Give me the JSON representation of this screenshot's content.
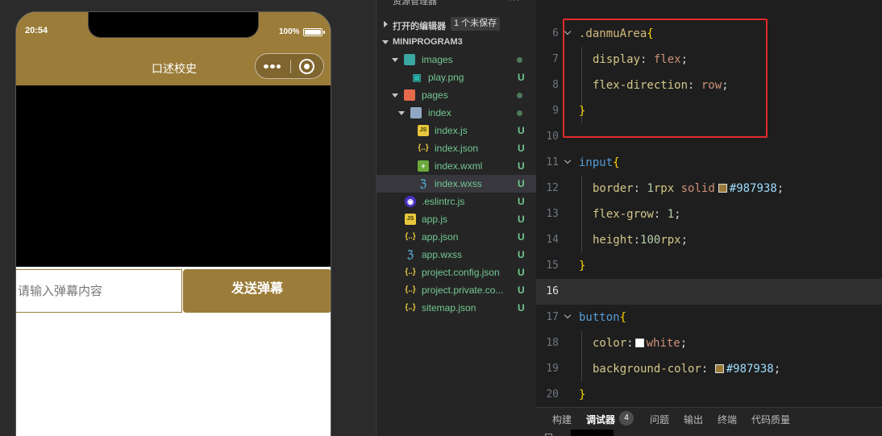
{
  "simulator": {
    "status_time": "20:54",
    "battery_percent": "100%",
    "battery_level": 1.0,
    "nav_title": "口述校史",
    "input_placeholder": "请输入弹幕内容",
    "send_button_label": "发送弹幕",
    "theme_color": "#9b7c39",
    "capsule_icons": [
      "more-icon",
      "close-icon"
    ]
  },
  "explorer": {
    "title": "资源管理器",
    "more_label": "···",
    "open_editors_label": "打开的编辑器",
    "unsaved_badge": "1 个未保存",
    "project_label": "MINIPROGRAM3",
    "items": [
      {
        "label": "images",
        "status": "",
        "icon": "folder-images-icon"
      },
      {
        "label": "play.png",
        "status": "U",
        "icon": "image-file-icon"
      },
      {
        "label": "pages",
        "status": "",
        "icon": "folder-pages-icon"
      },
      {
        "label": "index",
        "status": "",
        "icon": "folder-open-icon"
      },
      {
        "label": "index.js",
        "status": "U",
        "icon": "js-file-icon"
      },
      {
        "label": "index.json",
        "status": "U",
        "icon": "json-file-icon"
      },
      {
        "label": "index.wxml",
        "status": "U",
        "icon": "wxml-file-icon"
      },
      {
        "label": "index.wxss",
        "status": "U",
        "icon": "wxss-file-icon"
      },
      {
        "label": ".eslintrc.js",
        "status": "U",
        "icon": "eslint-file-icon"
      },
      {
        "label": "app.js",
        "status": "U",
        "icon": "js-file-icon"
      },
      {
        "label": "app.json",
        "status": "U",
        "icon": "json-file-icon"
      },
      {
        "label": "app.wxss",
        "status": "U",
        "icon": "wxss-file-icon"
      },
      {
        "label": "project.config.json",
        "status": "U",
        "icon": "json-file-icon"
      },
      {
        "label": "project.private.co...",
        "status": "U",
        "icon": "json-file-icon"
      },
      {
        "label": "sitemap.json",
        "status": "U",
        "icon": "json-file-icon"
      }
    ]
  },
  "editor": {
    "breadcrumb": "› ›",
    "line_numbers": [
      "6",
      "7",
      "8",
      "9",
      "10",
      "11",
      "12",
      "13",
      "14",
      "15",
      "16",
      "17",
      "18",
      "19",
      "20"
    ],
    "current_line": "16",
    "code": {
      "l6_selector": ".danmuArea",
      "l7_prop": "display",
      "l7_val": "flex",
      "l8_prop": "flex-direction",
      "l8_val": "row",
      "l11_selector": "input",
      "l12_prop": "border",
      "l12_num": "1",
      "l12_unit": "rpx",
      "l12_val": "solid",
      "l12_hex": "#987938",
      "l13_prop": "flex-grow",
      "l13_num": "1",
      "l14_prop": "height",
      "l14_num": "100",
      "l14_unit": "rpx",
      "l17_selector": "button",
      "l18_prop": "color",
      "l18_val": "white",
      "l19_prop": "background-color",
      "l19_hex": "#987938",
      "open_brace": "{",
      "close_brace": "}",
      "colon": ":",
      "semicolon": ";"
    },
    "swatch_colors": {
      "gold": "#987938",
      "white": "#ffffff"
    },
    "highlight_color": "#e32b2b"
  },
  "panel": {
    "tabs": [
      "构建",
      "调试器",
      "问题",
      "输出",
      "终端",
      "代码质量"
    ],
    "active_tab": "调试器",
    "debugger_badge": "4"
  }
}
